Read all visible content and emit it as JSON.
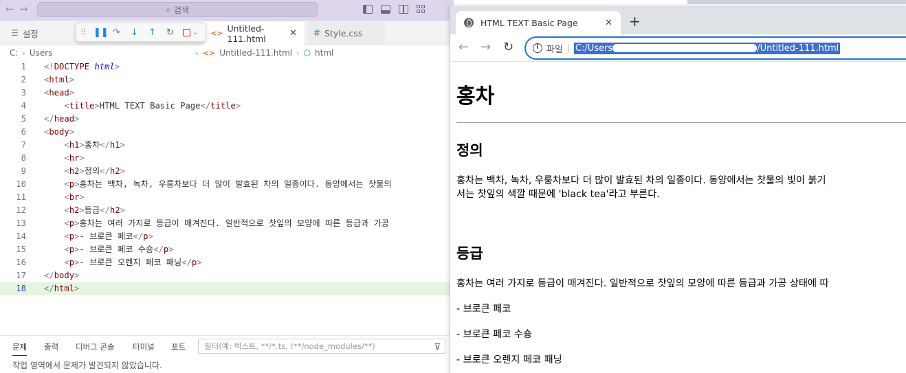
{
  "vscode": {
    "search_placeholder": "검색",
    "settings_tab": "설정",
    "tabs": [
      {
        "label": "Untitled-111.html",
        "icon": "html-icon",
        "active": true
      },
      {
        "label": "Style.css",
        "icon": "css-icon",
        "active": false
      }
    ],
    "breadcrumb": {
      "drive": "C:",
      "users": "Users",
      "file": "Untitled-111.html",
      "symbol": "html"
    },
    "code_lines": [
      {
        "n": "1",
        "html": "<span class=\"br\">&lt;!</span><span class=\"tg\">DOCTYPE</span> <span class=\"kw\" style=\"font-style:italic\">html</span><span class=\"br\">&gt;</span>"
      },
      {
        "n": "2",
        "html": "<span class=\"br\">&lt;</span><span class=\"tg\">html</span><span class=\"br\">&gt;</span>"
      },
      {
        "n": "3",
        "html": "<span class=\"br\">&lt;</span><span class=\"tg\">head</span><span class=\"br\">&gt;</span>"
      },
      {
        "n": "4",
        "html": "    <span class=\"br\">&lt;</span><span class=\"tg\">title</span><span class=\"br\">&gt;</span>HTML TEXT Basic Page<span class=\"br\">&lt;/</span><span class=\"tg\">title</span><span class=\"br\">&gt;</span>"
      },
      {
        "n": "5",
        "html": "<span class=\"br\">&lt;/</span><span class=\"tg\">head</span><span class=\"br\">&gt;</span>"
      },
      {
        "n": "6",
        "html": "<span class=\"br\">&lt;</span><span class=\"tg\">body</span><span class=\"br\">&gt;</span>"
      },
      {
        "n": "7",
        "html": "    <span class=\"br\">&lt;</span><span class=\"tg\">h1</span><span class=\"br\">&gt;</span>홍차<span class=\"br\">&lt;/</span><span class=\"tg\">h1</span><span class=\"br\">&gt;</span>"
      },
      {
        "n": "8",
        "html": "    <span class=\"br\">&lt;</span><span class=\"tg\">hr</span><span class=\"br\">&gt;</span>"
      },
      {
        "n": "9",
        "html": "    <span class=\"br\">&lt;</span><span class=\"tg\">h2</span><span class=\"br\">&gt;</span>정의<span class=\"br\">&lt;/</span><span class=\"tg\">h2</span><span class=\"br\">&gt;</span>"
      },
      {
        "n": "10",
        "html": "    <span class=\"br\">&lt;</span><span class=\"tg\">p</span><span class=\"br\">&gt;</span>홍차는 백차, 녹차, 우룽차보다 더 많이 발효된 차의 일종이다. 동양에서는 찻물의"
      },
      {
        "n": "11",
        "html": "    <span class=\"br\">&lt;</span><span class=\"tg\">br</span><span class=\"br\">&gt;</span>"
      },
      {
        "n": "12",
        "html": "    <span class=\"br\">&lt;</span><span class=\"tg\">h2</span><span class=\"br\">&gt;</span>등급<span class=\"br\">&lt;/</span><span class=\"tg\">h2</span><span class=\"br\">&gt;</span>"
      },
      {
        "n": "13",
        "html": "    <span class=\"br\">&lt;</span><span class=\"tg\">p</span><span class=\"br\">&gt;</span>홍차는 여러 가지로 등급이 매겨진다. 일반적으로 찻잎의 모양에 따른 등급과 가공"
      },
      {
        "n": "14",
        "html": "    <span class=\"br\">&lt;</span><span class=\"tg\">p</span><span class=\"br\">&gt;</span>- 브로큰 페코<span class=\"br\">&lt;/</span><span class=\"tg\">p</span><span class=\"br\">&gt;</span>"
      },
      {
        "n": "15",
        "html": "    <span class=\"br\">&lt;</span><span class=\"tg\">p</span><span class=\"br\">&gt;</span>- 브로큰 페코 수숑<span class=\"br\">&lt;/</span><span class=\"tg\">p</span><span class=\"br\">&gt;</span>"
      },
      {
        "n": "16",
        "html": "    <span class=\"br\">&lt;</span><span class=\"tg\">p</span><span class=\"br\">&gt;</span>- 브로큰 오렌지 페코 패닝<span class=\"br\">&lt;/</span><span class=\"tg\">p</span><span class=\"br\">&gt;</span>"
      },
      {
        "n": "17",
        "html": "<span class=\"br\">&lt;/</span><span class=\"tg\">body</span><span class=\"br\">&gt;</span>"
      },
      {
        "n": "18",
        "html": "<span class=\"br\">&lt;/</span><span class=\"tg\">html</span><span class=\"br\">&gt;</span>",
        "current": true
      }
    ],
    "panel": {
      "tabs": [
        "문제",
        "출력",
        "디버그 콘솔",
        "터미널",
        "포트"
      ],
      "filter_placeholder": "필터(예: 텍스트, **/*.ts, !**/node_modules/**)",
      "message": "작업 영역에서 문제가 발견되지 않았습니다."
    }
  },
  "chrome": {
    "tab_title": "HTML TEXT Basic Page",
    "scheme_label": "파일",
    "url_prefix": "C:/Users",
    "url_suffix": "/Untitled-111.html",
    "page": {
      "h1": "홍차",
      "h2_definition": "정의",
      "p_definition_1": "홍차는 백차, 녹차, 우룽차보다 더 많이 발효된 차의 일종이다. 동양에서는 찻물의 빛이 붉기",
      "p_definition_2": "서는 찻잎의 색깔 때문에 'black tea'라고 부른다.",
      "h2_grade": "등급",
      "p_grade": "홍차는 여러 가지로 등급이 매겨진다. 일반적으로 찻잎의 모양에 따른 등급과 가공 상태에 따",
      "items": [
        "- 브로큰 페코",
        "- 브로큰 페코 수숑",
        "- 브로큰 오렌지 페코 패닝"
      ]
    }
  }
}
